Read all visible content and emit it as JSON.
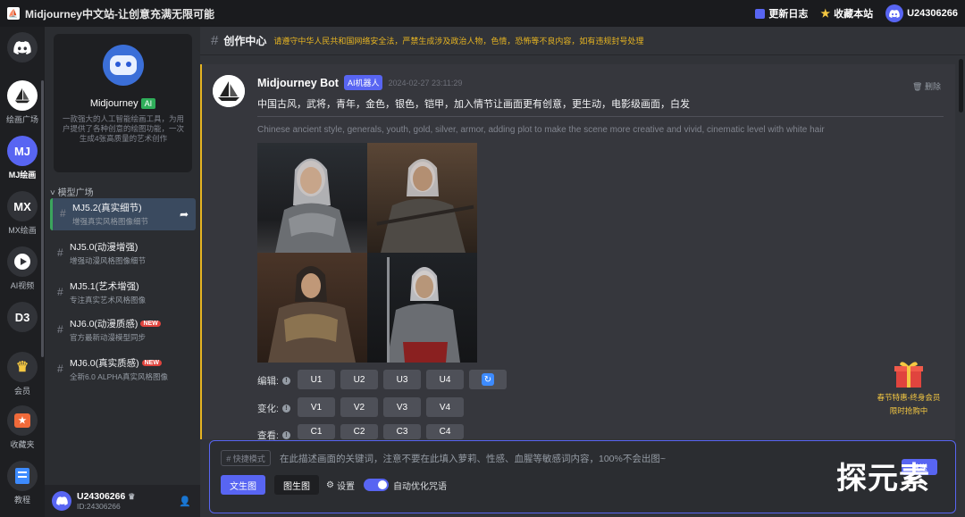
{
  "titlebar": {
    "title": "Midjourney中文站-让创意充满无限可能",
    "changelog": "更新日志",
    "bookmark": "收藏本站",
    "user": "U24306266"
  },
  "rail": {
    "items": [
      {
        "label": "",
        "icon": "discord-icon"
      },
      {
        "label": "绘画广场",
        "icon": "sailboat-icon"
      },
      {
        "label": "MJ绘画",
        "icon": "MJ"
      },
      {
        "label": "MX绘画",
        "icon": "MX"
      },
      {
        "label": "AI视频",
        "icon": "play-icon"
      },
      {
        "label": "",
        "icon": "D3"
      },
      {
        "label": "会员",
        "icon": "crown-icon"
      },
      {
        "label": "收藏夹",
        "icon": "star-folder-icon"
      },
      {
        "label": "教程",
        "icon": "book-icon"
      }
    ]
  },
  "panel": {
    "bot_name": "Midjourney",
    "ai_tag": "AI",
    "bot_desc": "一款强大的人工智能绘画工具，为用户提供了各种创意的绘图功能，一次生成4张高质量的艺术创作",
    "section_title": "模型广场",
    "models": [
      {
        "name": "MJ5.2(真实细节)",
        "sub": "增强真实风格图像细节",
        "new": ""
      },
      {
        "name": "NJ5.0(动漫增强)",
        "sub": "增强动漫风格图像细节",
        "new": ""
      },
      {
        "name": "MJ5.1(艺术增强)",
        "sub": "专注真实艺术风格图像",
        "new": ""
      },
      {
        "name": "NJ6.0(动漫质感)",
        "sub": "官方最新动漫模型同步",
        "new": "NEW"
      },
      {
        "name": "MJ6.0(真实质感)",
        "sub": "全新6.0 ALPHA真实风格图像",
        "new": "NEW"
      }
    ],
    "user_name": "U24306266",
    "user_id": "ID:24306266"
  },
  "channel": {
    "name": "创作中心",
    "warning": "请遵守中华人民共和国网络安全法，严禁生成涉及政治人物，色情，恐怖等不良内容，如有违规封号处理"
  },
  "message": {
    "author": "Midjourney Bot",
    "badge": "AI机器人",
    "time": "2024-02-27 23:11:29",
    "delete": "删除",
    "prompt_cn": "中国古风，武将，青年，金色，银色，铠甲，加入情节让画面更有创意，更生动，电影级画面，白发",
    "prompt_en": "Chinese ancient style, generals, youth, gold, silver, armor, adding plot to make the scene more creative and vivid, cinematic level with white hair",
    "rows": [
      {
        "label": "编辑:",
        "buttons": [
          "U1",
          "U2",
          "U3",
          "U4"
        ]
      },
      {
        "label": "变化:",
        "buttons": [
          "V1",
          "V2",
          "V3",
          "V4"
        ]
      },
      {
        "label": "查看:",
        "buttons": [
          "C1",
          "C2",
          "C3",
          "C4"
        ]
      }
    ]
  },
  "promo": {
    "text1": "春节特惠-终身会员",
    "text2": "限时抢购中"
  },
  "composer": {
    "quick_mode": "# 快捷模式",
    "placeholder": "在此描述画面的关键词，注意不要在此填入萝莉、性感、血腥等敏感词内容，100%不会出图~",
    "send": "发送",
    "text_to_image": "文生图",
    "image_to_image": "图生图",
    "settings": "设置",
    "auto_optimize": "自动优化咒语"
  },
  "watermark": "探元素",
  "colors": {
    "accent": "#5865f2",
    "gold": "#e6b422",
    "green": "#2fae5a",
    "new": "#e0443e"
  }
}
